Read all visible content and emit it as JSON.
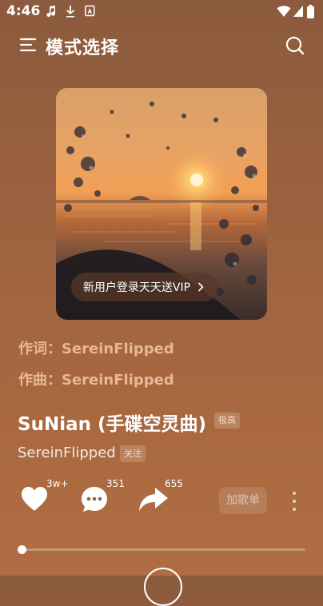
{
  "status_bar": {
    "time": "4:46"
  },
  "header": {
    "title": "模式选择"
  },
  "album": {
    "promo_label": "新用户登录天天送VIP"
  },
  "info": {
    "lyricist": "作词：SereinFlipped",
    "composer": "作曲：SereinFlipped",
    "song_title": "SuNian (手碟空灵曲)",
    "quality_badge": "极高",
    "artist": "SereinFlipped",
    "follow_label": "关注"
  },
  "actions": {
    "like_count": "3w+",
    "comment_count": "351",
    "share_count": "655",
    "add_playlist_label": "加歌单"
  },
  "player": {
    "progress": 0
  }
}
